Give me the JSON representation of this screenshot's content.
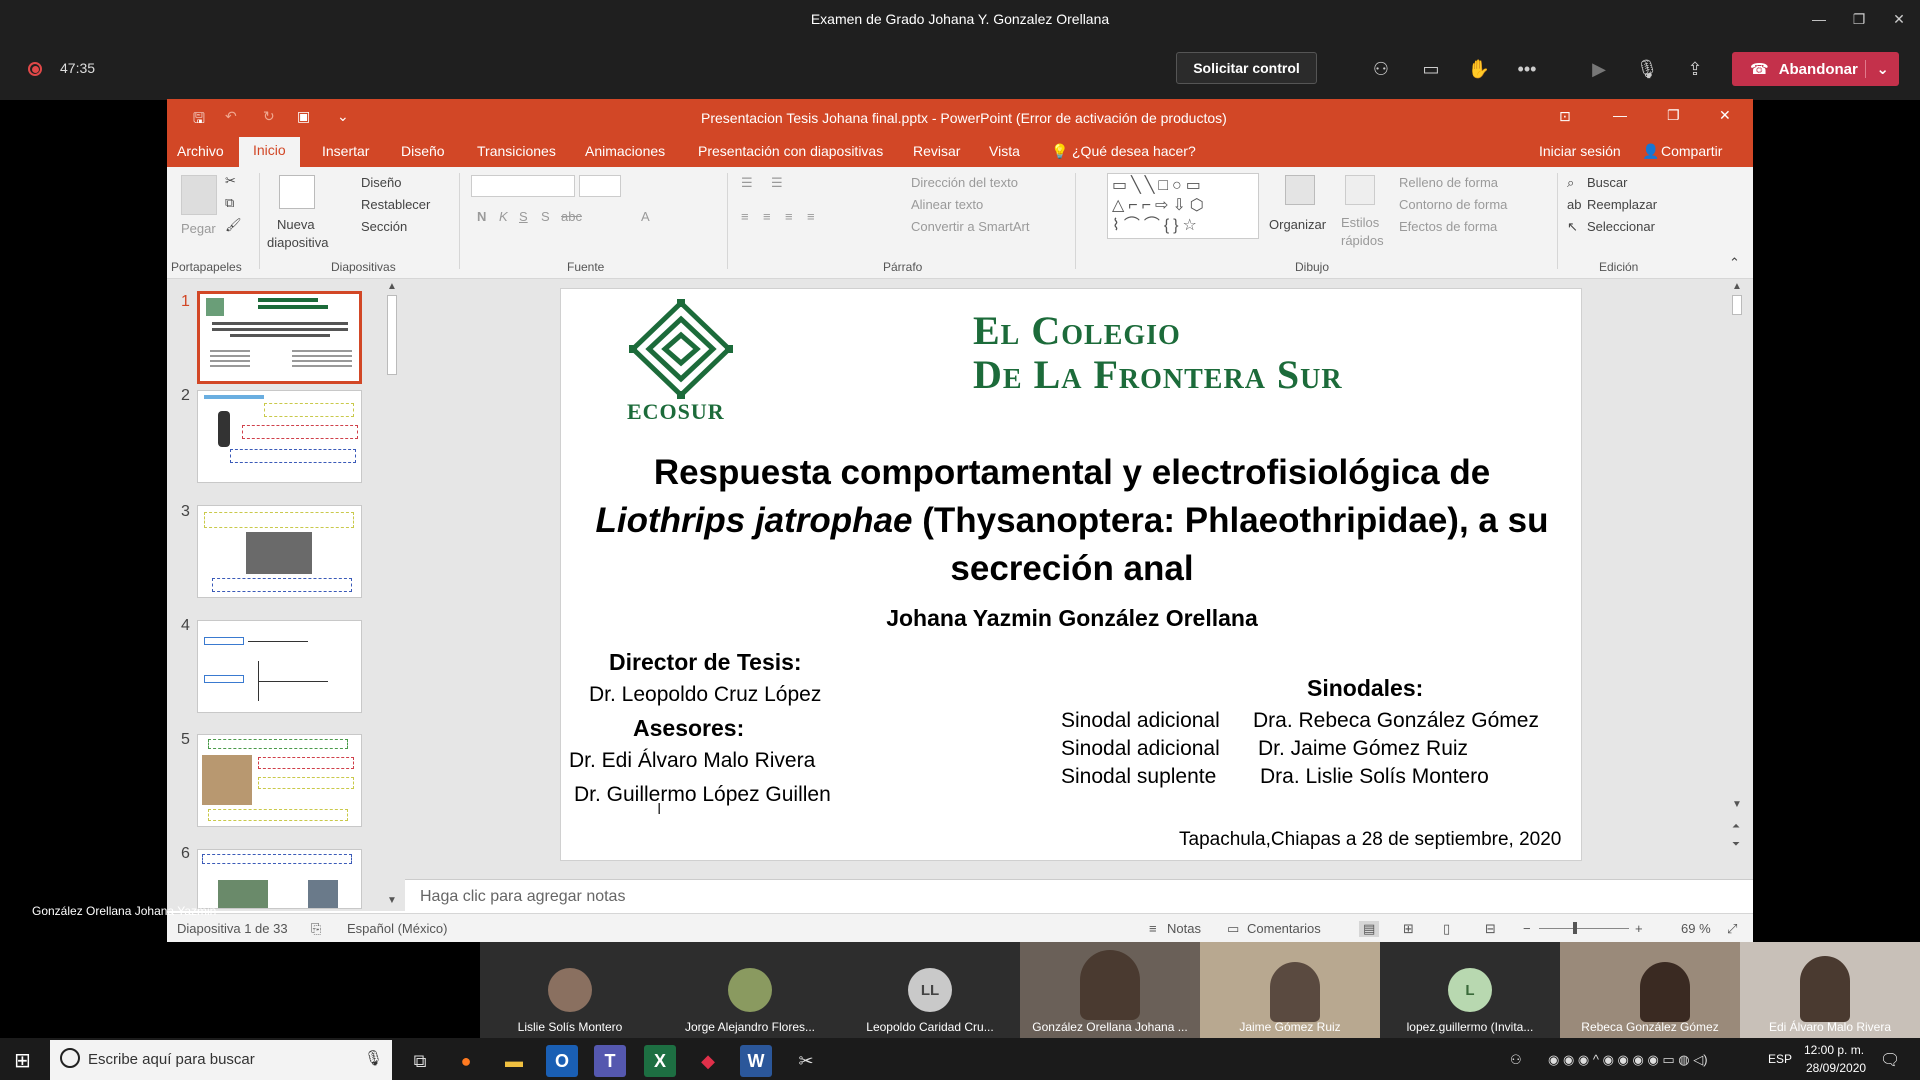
{
  "teams": {
    "window_title": "Examen de Grado Johana Y. Gonzalez Orellana",
    "timer": "47:35",
    "request_control": "Solicitar control",
    "leave": "Abandonar"
  },
  "ppt": {
    "title": "Presentacion Tesis Johana final.pptx - PowerPoint (Error de activación de productos)",
    "tabs": [
      "Archivo",
      "Inicio",
      "Insertar",
      "Diseño",
      "Transiciones",
      "Animaciones",
      "Presentación con diapositivas",
      "Revisar",
      "Vista"
    ],
    "tell_me": "¿Qué desea hacer?",
    "signin": "Iniciar sesión",
    "share": "Compartir",
    "ribbon": {
      "pegar": "Pegar",
      "portapapeles": "Portapapeles",
      "nueva": "Nueva",
      "diapositiva": "diapositiva",
      "diseno": "Diseño",
      "restablecer": "Restablecer",
      "seccion": "Sección",
      "diapositivas": "Diapositivas",
      "fuente": "Fuente",
      "direccion": "Dirección del texto",
      "alinear": "Alinear texto",
      "convertir": "Convertir a SmartArt",
      "parrafo": "Párrafo",
      "organizar": "Organizar",
      "estilos": "Estilos",
      "rapidos": "rápidos",
      "relleno": "Relleno de forma",
      "contorno": "Contorno de forma",
      "efectos": "Efectos de forma",
      "dibujo": "Dibujo",
      "buscar": "Buscar",
      "reemplazar": "Reemplazar",
      "seleccionar": "Seleccionar",
      "edicion": "Edición"
    },
    "thumbs": [
      "1",
      "2",
      "3",
      "4",
      "5",
      "6"
    ],
    "notes_placeholder": "Haga clic para agregar notas",
    "status": {
      "slide": "Diapositiva 1 de 33",
      "language": "Español (México)",
      "notes": "Notas",
      "comments": "Comentarios",
      "zoom": "69 %"
    }
  },
  "slide": {
    "logo_text": "ECOSUR",
    "colegio_line1": "El Colegio",
    "colegio_line2": "De La Frontera Sur",
    "title_line1": "Respuesta comportamental y electrofisiológica de",
    "title_italic": "Liothrips jatrophae",
    "title_line2_rest": " (Thysanoptera: Phlaeothripidae), a su",
    "title_line3": "secreción anal",
    "author": "Johana Yazmin González Orellana",
    "director_label": "Director de Tesis:",
    "director": "Dr. Leopoldo Cruz López",
    "asesores_label": "Asesores:",
    "asesor1": "Dr. Edi Álvaro Malo Rivera",
    "asesor2": "Dr. Guillermo López Guillen",
    "sinodales_label": "Sinodales:",
    "sinodales": [
      {
        "role": "Sinodal adicional",
        "name": "Dra. Rebeca González Gómez"
      },
      {
        "role": "Sinodal adicional",
        "name": "Dr. Jaime Gómez Ruiz"
      },
      {
        "role": "Sinodal suplente",
        "name": "Dra. Lislie Solís Montero"
      }
    ],
    "place_date": "Tapachula,Chiapas a 28 de septiembre, 2020"
  },
  "speaker_label": "González Orellana Johana Yazmin",
  "participants": [
    {
      "name": "Lislie Solís Montero",
      "initials": ""
    },
    {
      "name": "Jorge Alejandro Flores...",
      "initials": ""
    },
    {
      "name": "Leopoldo Caridad Cru...",
      "initials": "LL"
    },
    {
      "name": "González Orellana Johana ...",
      "initials": ""
    },
    {
      "name": "Jaime Gómez Ruiz",
      "initials": ""
    },
    {
      "name": "lopez.guillermo (Invita...",
      "initials": "L"
    },
    {
      "name": "Rebeca González Gómez",
      "initials": ""
    },
    {
      "name": "Edi Álvaro Malo Rivera",
      "initials": ""
    }
  ],
  "taskbar": {
    "search_placeholder": "Escribe aquí para buscar",
    "lang": "ESP",
    "time": "12:00 p. m.",
    "date": "28/09/2020"
  },
  "colors": {
    "ppt_accent": "#d24726",
    "teams_leave": "#c4314b",
    "ecosur_green": "#1c6b3a"
  }
}
